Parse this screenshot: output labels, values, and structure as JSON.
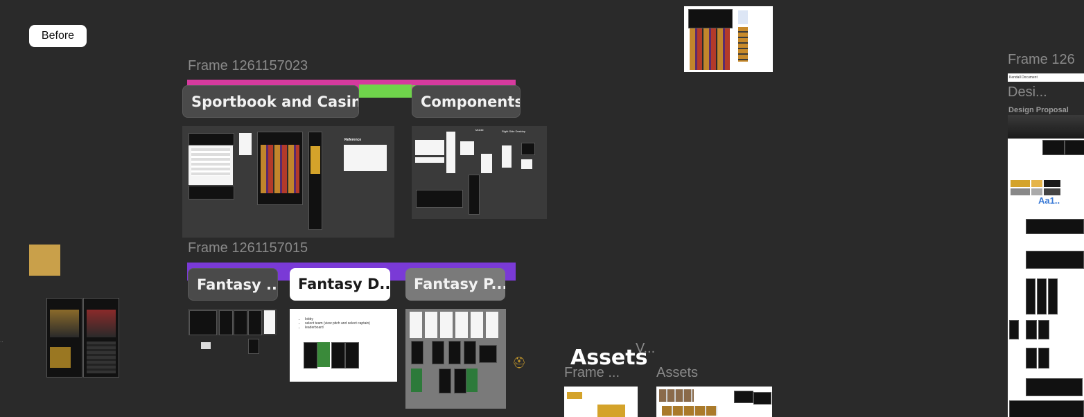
{
  "before_button": "Before",
  "frames": {
    "frame_a_label": "Frame 1261157023",
    "frame_b_label": "Frame 1261157015",
    "frame_right_label": "Frame 126",
    "frame_assets_label": "Frame ...",
    "assets_label": "Assets"
  },
  "sections": {
    "sportbook": "Sportbook and Casino",
    "components": "Components",
    "fantasy_1": "Fantasy ...",
    "fantasy_2": "Fantasy D...",
    "fantasy_3": "Fantasy P..."
  },
  "thumb_text": {
    "reference": "Reference",
    "mobile": "Mobile",
    "right_side_desktop": "Right Side Desktop",
    "bullets": [
      "lobby",
      "select team (view pitch and select captain)",
      "leaderboard"
    ]
  },
  "assets_heading": "Assets",
  "assets_suffix": "V...",
  "right_panel": {
    "search_text": "Kendall Document",
    "title": "Desi...",
    "subtitle": "Design Proposal",
    "typography": "Aa1.."
  },
  "colors": {
    "canvas": "#2a2a2a",
    "bar_pink": "#d63a9e",
    "bar_green": "#6fd44b",
    "bar_purple": "#7a3ad6",
    "gold": "#d4a32a"
  }
}
